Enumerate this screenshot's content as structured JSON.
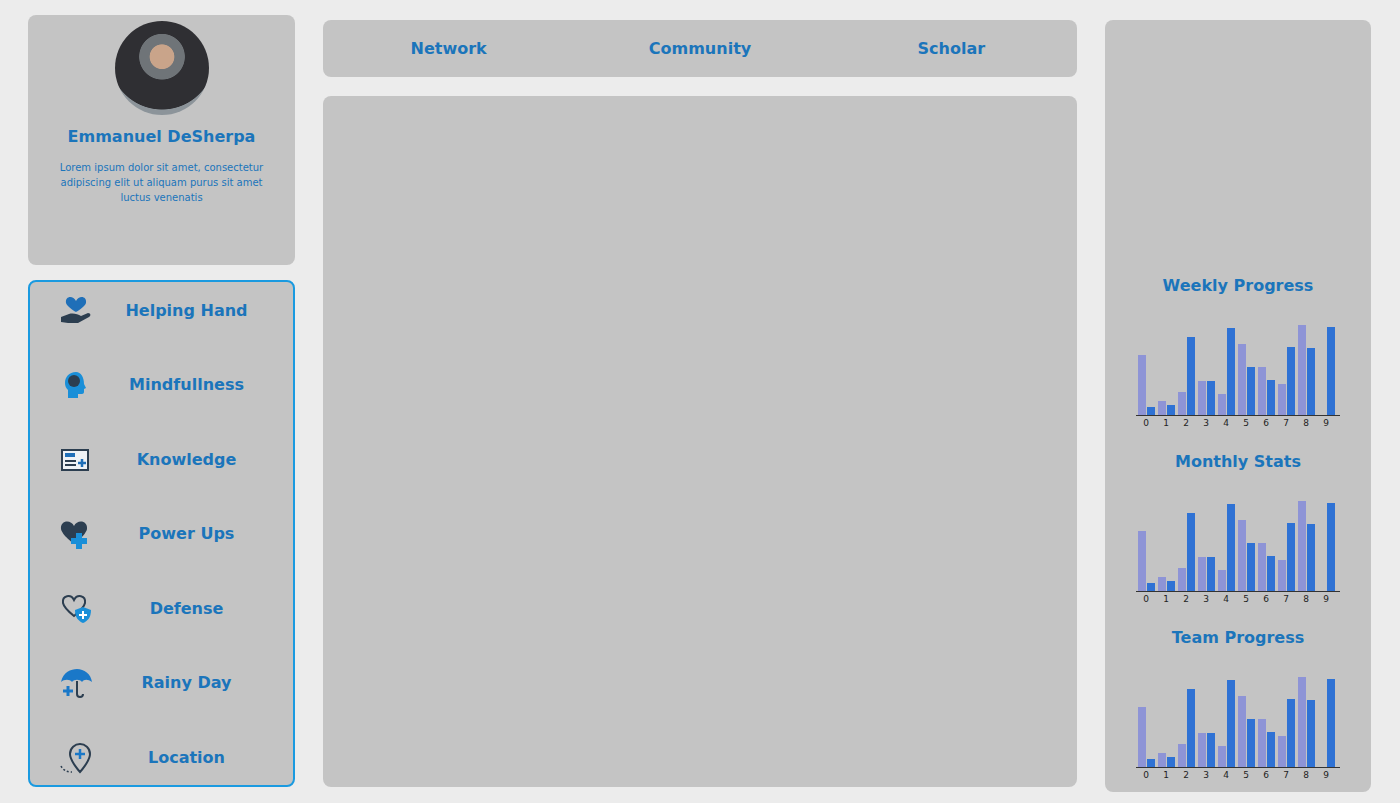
{
  "profile": {
    "name": "Emmanuel DeSherpa",
    "bio": "Lorem ipsum dolor sit amet, consectetur adipiscing elit ut aliquam purus sit amet luctus venenatis"
  },
  "nav": [
    {
      "label": "Network"
    },
    {
      "label": "Community"
    },
    {
      "label": "Scholar"
    }
  ],
  "sidebar": {
    "items": [
      {
        "label": "Helping Hand"
      },
      {
        "label": "Mindfullness"
      },
      {
        "label": "Knowledge"
      },
      {
        "label": "Power Ups"
      },
      {
        "label": "Defense"
      },
      {
        "label": "Rainy Day"
      },
      {
        "label": "Location"
      }
    ]
  },
  "charts": [
    {
      "title": "Weekly Progress",
      "ticks": [
        "0",
        "1",
        "2",
        "3",
        "4",
        "5",
        "6",
        "7",
        "8",
        "9"
      ],
      "series": [
        {
          "color": "#8e94d6",
          "values": [
            63,
            15,
            24,
            36,
            22,
            75,
            50,
            33,
            95,
            0
          ]
        },
        {
          "color": "#2f72d4",
          "values": [
            8,
            10,
            82,
            36,
            92,
            50,
            37,
            72,
            71,
            93
          ]
        }
      ]
    },
    {
      "title": "Monthly Stats",
      "ticks": [
        "0",
        "1",
        "2",
        "3",
        "4",
        "5",
        "6",
        "7",
        "8",
        "9"
      ],
      "series": [
        {
          "color": "#8e94d6",
          "values": [
            63,
            15,
            24,
            36,
            22,
            75,
            50,
            33,
            95,
            0
          ]
        },
        {
          "color": "#2f72d4",
          "values": [
            8,
            10,
            82,
            36,
            92,
            50,
            37,
            72,
            71,
            93
          ]
        }
      ]
    },
    {
      "title": "Team Progress",
      "ticks": [
        "0",
        "1",
        "2",
        "3",
        "4",
        "5",
        "6",
        "7",
        "8",
        "9"
      ],
      "series": [
        {
          "color": "#8e94d6",
          "values": [
            63,
            15,
            24,
            36,
            22,
            75,
            50,
            33,
            95,
            0
          ]
        },
        {
          "color": "#2f72d4",
          "values": [
            8,
            10,
            82,
            36,
            92,
            50,
            37,
            72,
            71,
            93
          ]
        }
      ]
    }
  ]
}
